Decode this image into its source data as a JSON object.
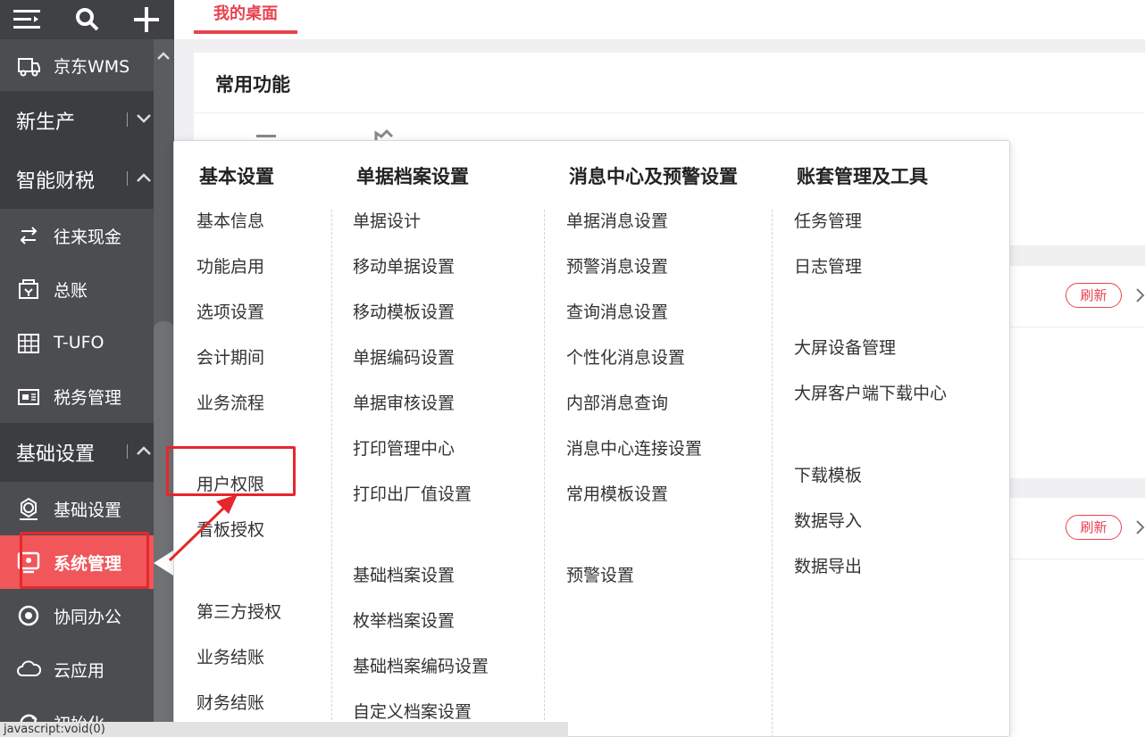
{
  "sidebar": {
    "top_icons": [
      "menu-icon",
      "search-icon",
      "plus-icon"
    ],
    "items": [
      {
        "label": "京东WMS",
        "icon": "truck-icon"
      },
      {
        "label": "新生产",
        "type": "section",
        "state": "collapsed"
      },
      {
        "label": "智能财税",
        "type": "section",
        "state": "expanded"
      },
      {
        "label": "往来现金",
        "icon": "exchange-icon"
      },
      {
        "label": "总账",
        "icon": "ledger-icon"
      },
      {
        "label": "T-UFO",
        "icon": "report-icon"
      },
      {
        "label": "税务管理",
        "icon": "tax-icon"
      },
      {
        "label": "基础设置",
        "type": "section",
        "state": "expanded"
      },
      {
        "label": "基础设置",
        "icon": "settings-icon"
      },
      {
        "label": "系统管理",
        "icon": "system-icon",
        "active": true
      },
      {
        "label": "协同办公",
        "icon": "collab-icon"
      },
      {
        "label": "云应用",
        "icon": "cloud-icon"
      },
      {
        "label": "初始化",
        "icon": "init-icon"
      }
    ]
  },
  "tabs": [
    {
      "label": "我的桌面",
      "active": true
    }
  ],
  "panels": {
    "common_title": "常用功能",
    "refresh_label": "刷新"
  },
  "menu": {
    "columns": [
      {
        "heading": "基本设置",
        "items": [
          "基本信息",
          "功能启用",
          "选项设置",
          "会计期间",
          "业务流程",
          "",
          "用户权限",
          "看板授权",
          "",
          "第三方授权",
          "业务结账",
          "财务结账"
        ]
      },
      {
        "heading": "单据档案设置",
        "items": [
          "单据设计",
          "移动单据设置",
          "移动模板设置",
          "单据编码设置",
          "单据审核设置",
          "打印管理中心",
          "打印出厂值设置",
          "",
          "基础档案设置",
          "枚举档案设置",
          "基础档案编码设置",
          "自定义档案设置"
        ]
      },
      {
        "heading": "消息中心及预警设置",
        "items": [
          "单据消息设置",
          "预警消息设置",
          "查询消息设置",
          "个性化消息设置",
          "内部消息查询",
          "消息中心连接设置",
          "常用模板设置",
          "",
          "预警设置"
        ]
      },
      {
        "heading": "账套管理及工具",
        "items": [
          "任务管理",
          "日志管理",
          "",
          "大屏设备管理",
          "大屏客户端下载中心",
          "",
          "下载模板",
          "数据导入",
          "数据导出"
        ]
      }
    ]
  },
  "status_bar": "javascript:void(0)",
  "colors": {
    "accent": "#e8434f",
    "sidebar": "#4b4d50",
    "highlight_box": "#e6262b"
  }
}
